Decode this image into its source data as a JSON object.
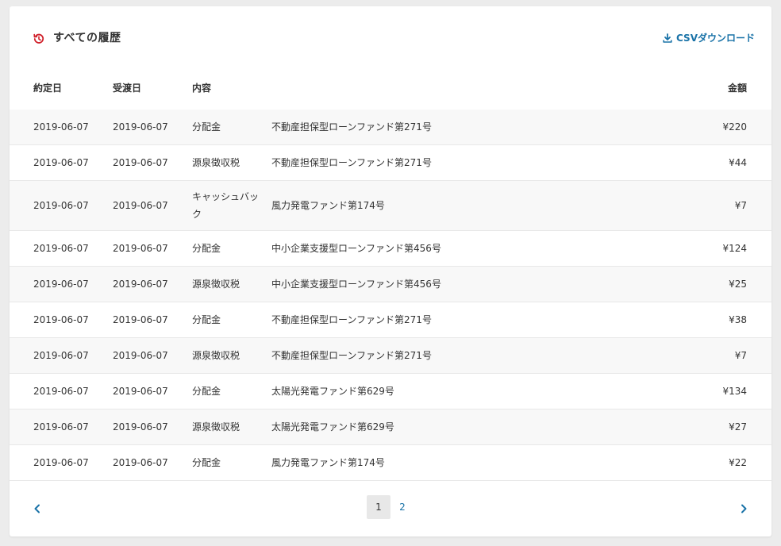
{
  "header": {
    "title": "すべての履歴",
    "csv_label": "CSVダウンロード"
  },
  "columns": {
    "yakujo": "約定日",
    "jutou": "受渡日",
    "naiyou": "内容",
    "amount": "金額"
  },
  "rows": [
    {
      "yakujo": "2019-06-07",
      "jutou": "2019-06-07",
      "naiyou": "分配金",
      "fund": "不動産担保型ローンファンド第271号",
      "amount": "¥220"
    },
    {
      "yakujo": "2019-06-07",
      "jutou": "2019-06-07",
      "naiyou": "源泉徴収税",
      "fund": "不動産担保型ローンファンド第271号",
      "amount": "¥44"
    },
    {
      "yakujo": "2019-06-07",
      "jutou": "2019-06-07",
      "naiyou": "キャッシュバック",
      "fund": "風力発電ファンド第174号",
      "amount": "¥7"
    },
    {
      "yakujo": "2019-06-07",
      "jutou": "2019-06-07",
      "naiyou": "分配金",
      "fund": "中小企業支援型ローンファンド第456号",
      "amount": "¥124"
    },
    {
      "yakujo": "2019-06-07",
      "jutou": "2019-06-07",
      "naiyou": "源泉徴収税",
      "fund": "中小企業支援型ローンファンド第456号",
      "amount": "¥25"
    },
    {
      "yakujo": "2019-06-07",
      "jutou": "2019-06-07",
      "naiyou": "分配金",
      "fund": "不動産担保型ローンファンド第271号",
      "amount": "¥38"
    },
    {
      "yakujo": "2019-06-07",
      "jutou": "2019-06-07",
      "naiyou": "源泉徴収税",
      "fund": "不動産担保型ローンファンド第271号",
      "amount": "¥7"
    },
    {
      "yakujo": "2019-06-07",
      "jutou": "2019-06-07",
      "naiyou": "分配金",
      "fund": "太陽光発電ファンド第629号",
      "amount": "¥134"
    },
    {
      "yakujo": "2019-06-07",
      "jutou": "2019-06-07",
      "naiyou": "源泉徴収税",
      "fund": "太陽光発電ファンド第629号",
      "amount": "¥27"
    },
    {
      "yakujo": "2019-06-07",
      "jutou": "2019-06-07",
      "naiyou": "分配金",
      "fund": "風力発電ファンド第174号",
      "amount": "¥22"
    }
  ],
  "pagination": {
    "pages": [
      "1",
      "2"
    ],
    "current": "1"
  },
  "icons": {
    "title_icon": "history-clock-icon",
    "csv_icon": "download-icon",
    "prev_icon": "chevron-left-icon",
    "next_icon": "chevron-right-icon"
  },
  "colors": {
    "accent": "#1a73a8",
    "history_icon": "#d0202a"
  }
}
